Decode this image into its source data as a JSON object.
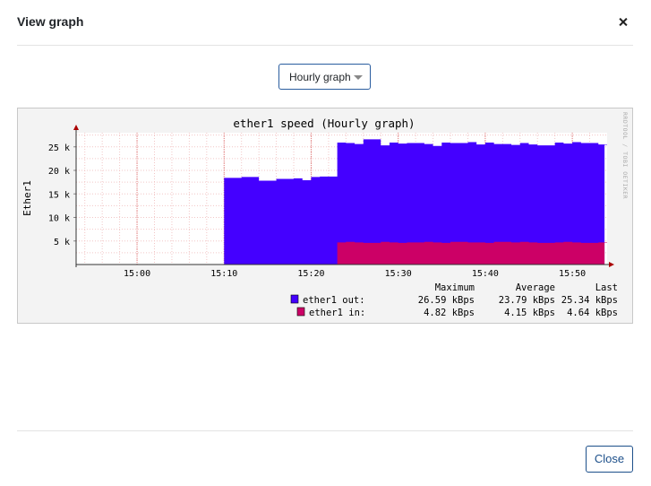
{
  "modal": {
    "title": "View graph",
    "close_button_label": "Close"
  },
  "period_select": {
    "selected": "Hourly graph"
  },
  "chart_data": {
    "type": "area",
    "title": "ether1 speed (Hourly graph)",
    "ylabel": "Ether1",
    "xlabel": "",
    "side_label": "RRDTOOL / TOBI OETIKER",
    "x_ticks": [
      "15:00",
      "15:10",
      "15:20",
      "15:30",
      "15:40",
      "15:50"
    ],
    "y_ticks": [
      "5 k",
      "10 k",
      "15 k",
      "20 k",
      "25 k"
    ],
    "ylim": [
      0,
      28000
    ],
    "x_range": [
      "14:53",
      "15:54"
    ],
    "x": [
      "15:10",
      "15:12",
      "15:14",
      "15:16",
      "15:18",
      "15:19",
      "15:20",
      "15:21",
      "15:23",
      "15:24",
      "15:25",
      "15:26",
      "15:28",
      "15:29",
      "15:30",
      "15:31",
      "15:33",
      "15:34",
      "15:35",
      "15:36",
      "15:38",
      "15:39",
      "15:40",
      "15:41",
      "15:43",
      "15:44",
      "15:45",
      "15:46",
      "15:48",
      "15:49",
      "15:50",
      "15:51",
      "15:53",
      "15:54"
    ],
    "series": [
      {
        "name": "ether1 out",
        "color": "#4400ff",
        "values": [
          18400,
          18600,
          17800,
          18200,
          18300,
          17900,
          18600,
          18700,
          25900,
          25800,
          25600,
          26600,
          25300,
          25900,
          25700,
          25800,
          25600,
          25200,
          25900,
          25800,
          26000,
          25500,
          25900,
          25600,
          25400,
          25800,
          25500,
          25300,
          25900,
          25700,
          26000,
          25800,
          25500,
          25400
        ]
      },
      {
        "name": "ether1 in",
        "color": "#cc0066",
        "values": [
          0,
          0,
          0,
          0,
          0,
          0,
          0,
          0,
          4700,
          4800,
          4700,
          4600,
          4800,
          4700,
          4600,
          4700,
          4800,
          4700,
          4600,
          4800,
          4700,
          4700,
          4600,
          4800,
          4700,
          4800,
          4700,
          4600,
          4700,
          4800,
          4700,
          4600,
          4700,
          4600
        ]
      }
    ],
    "legend": {
      "headers": [
        "Maximum",
        "Average",
        "Last"
      ],
      "rows": [
        {
          "label": "ether1 out:",
          "color": "#4400ff",
          "max": "26.59 kBps",
          "avg": "23.79 kBps",
          "last": "25.34 kBps"
        },
        {
          "label": "ether1 in:",
          "color": "#cc0066",
          "max": "4.82 kBps",
          "avg": "4.15 kBps",
          "last": "4.64 kBps"
        }
      ]
    },
    "grid": true,
    "legend_position": "bottom-right"
  }
}
